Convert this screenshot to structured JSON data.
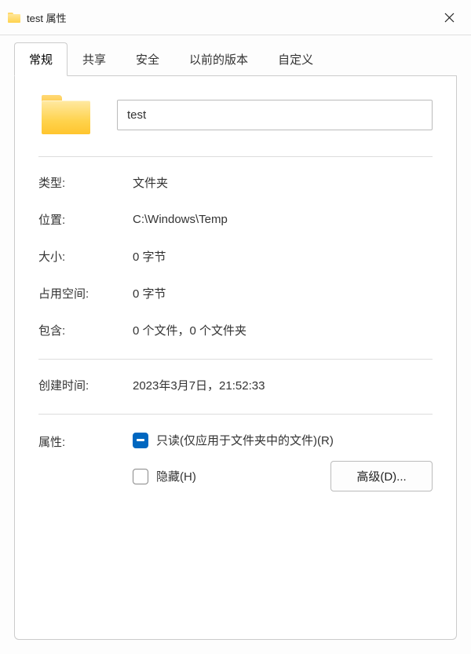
{
  "window": {
    "title": "test 属性"
  },
  "tabs": {
    "general": "常规",
    "sharing": "共享",
    "security": "安全",
    "previous": "以前的版本",
    "custom": "自定义"
  },
  "folder": {
    "name": "test"
  },
  "props": {
    "type_label": "类型:",
    "type_value": "文件夹",
    "location_label": "位置:",
    "location_value": "C:\\Windows\\Temp",
    "size_label": "大小:",
    "size_value": "0 字节",
    "size_on_disk_label": "占用空间:",
    "size_on_disk_value": "0 字节",
    "contains_label": "包含:",
    "contains_value": "0 个文件，0 个文件夹",
    "created_label": "创建时间:",
    "created_value": "2023年3月7日，21:52:33"
  },
  "attributes": {
    "label": "属性:",
    "readonly": "只读(仅应用于文件夹中的文件)(R)",
    "hidden": "隐藏(H)",
    "advanced": "高级(D)..."
  }
}
